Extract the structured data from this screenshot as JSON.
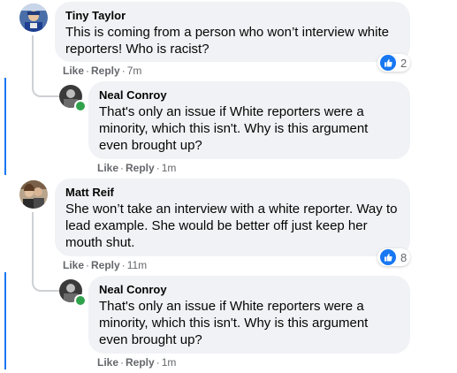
{
  "theme": {
    "accent": "#1877f2",
    "bubble_bg": "#f0f2f5",
    "meta_text": "#65676b",
    "online": "#31a24c"
  },
  "comments": [
    {
      "author": "Tiny Taylor",
      "text": "This is coming from a person who won’t interview white reporters! Who is racist?",
      "actions": {
        "like": "Like",
        "reply": "Reply",
        "time": "7m"
      },
      "reactions": {
        "icon": "thumbs-up-icon",
        "count": "2"
      }
    },
    {
      "author": "Neal Conroy",
      "text": "That's only an issue if White reporters were a minority, which this isn't. Why is this argument even brought up?",
      "actions": {
        "like": "Like",
        "reply": "Reply",
        "time": "1m"
      }
    },
    {
      "author": "Matt Reif",
      "text": "She won’t take an interview with a white reporter. Way to lead example. She would be better off just keep her mouth shut.",
      "actions": {
        "like": "Like",
        "reply": "Reply",
        "time": "11m"
      },
      "reactions": {
        "icon": "thumbs-up-icon",
        "count": "8"
      }
    },
    {
      "author": "Neal Conroy",
      "text": "That's only an issue if White reporters were a minority, which this isn't. Why is this argument even brought up?",
      "actions": {
        "like": "Like",
        "reply": "Reply",
        "time": "1m"
      }
    }
  ],
  "separator": "·"
}
